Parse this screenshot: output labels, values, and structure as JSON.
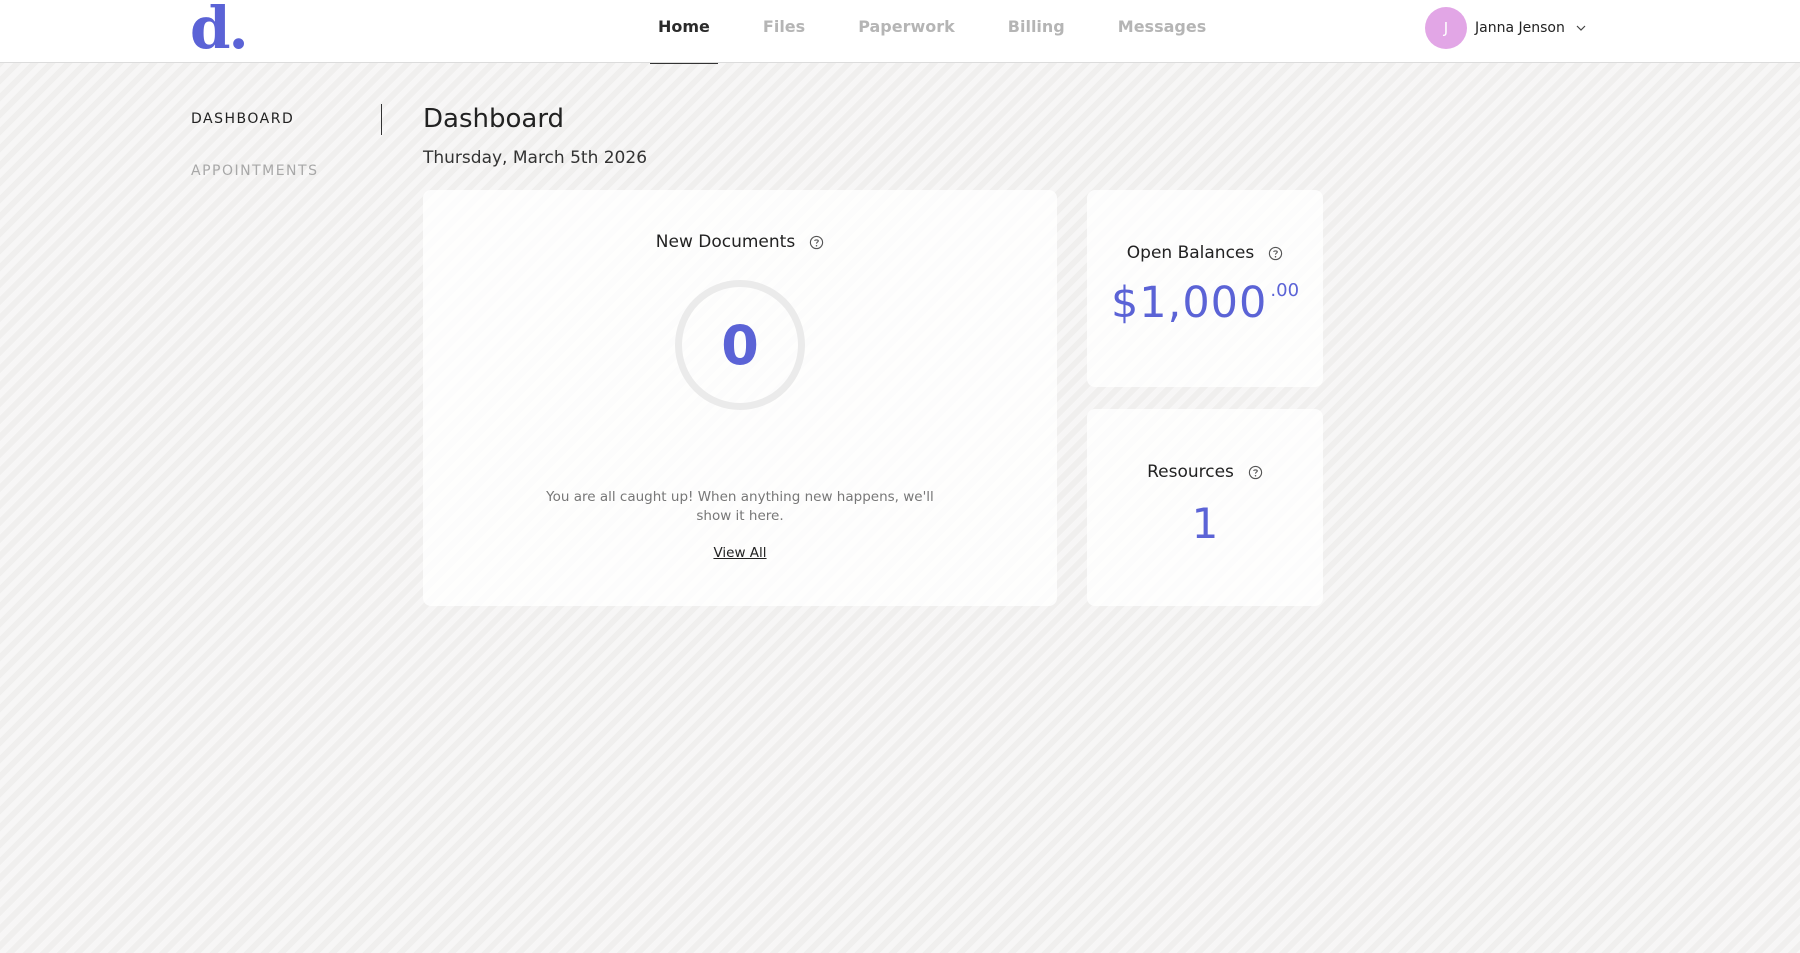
{
  "brand": {
    "logo_text": "d."
  },
  "nav": {
    "items": [
      {
        "label": "Home",
        "active": true
      },
      {
        "label": "Files",
        "active": false
      },
      {
        "label": "Paperwork",
        "active": false
      },
      {
        "label": "Billing",
        "active": false
      },
      {
        "label": "Messages",
        "active": false
      }
    ]
  },
  "user": {
    "initial": "J",
    "name": "Janna Jenson",
    "avatar_color": "#e2a6e6"
  },
  "sidebar": {
    "items": [
      {
        "label": "DASHBOARD",
        "active": true
      },
      {
        "label": "APPOINTMENTS",
        "active": false
      }
    ]
  },
  "main": {
    "title": "Dashboard",
    "date": "Thursday, March 5th 2026"
  },
  "cards": {
    "new_documents": {
      "title": "New Documents",
      "count": "0",
      "message": "You are all caught up! When anything new happens, we'll show it here.",
      "link_label": "View All"
    },
    "open_balances": {
      "title": "Open Balances",
      "amount": "$1,000",
      "cents": ".00"
    },
    "resources": {
      "title": "Resources",
      "count": "1"
    }
  },
  "colors": {
    "accent": "#5b63d6",
    "background": "#f3f2f1",
    "muted_text": "#a8a8a8"
  }
}
